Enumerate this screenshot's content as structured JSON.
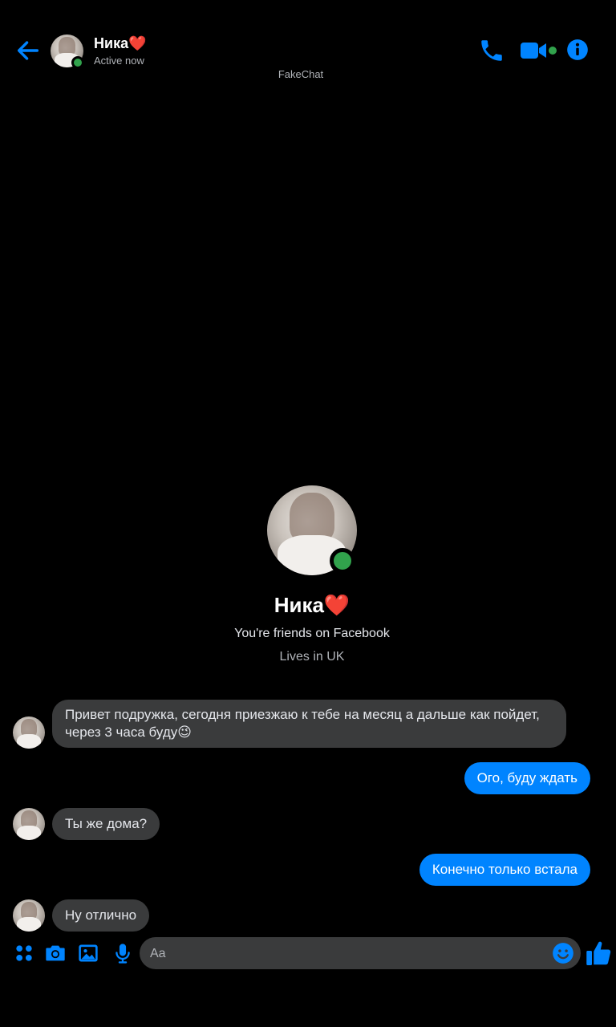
{
  "header": {
    "contact_name": "Ника❤️",
    "status": "Active now",
    "watermark": "FakeChat",
    "icons": [
      "back-arrow-icon",
      "phone-icon",
      "video-camera-icon",
      "info-icon"
    ]
  },
  "profile": {
    "name": "Ника❤️",
    "friends_text": "You're friends on Facebook",
    "location_text": "Lives in UK"
  },
  "messages": [
    {
      "direction": "incoming",
      "text": "Привет подружка, сегодня приезжаю к тебе на месяц а дальше как пойдет, через 3 часа буду😉"
    },
    {
      "direction": "outgoing",
      "text": "Ого, буду ждать"
    },
    {
      "direction": "incoming",
      "text": "Ты же дома?"
    },
    {
      "direction": "outgoing",
      "text": "Конечно только встала"
    },
    {
      "direction": "incoming",
      "text": "Ну отлично"
    }
  ],
  "composer": {
    "placeholder": "Aa",
    "icons": [
      "apps-grid-icon",
      "camera-icon",
      "gallery-icon",
      "microphone-icon",
      "emoji-icon",
      "thumbs-up-icon"
    ]
  },
  "colors": {
    "accent": "#0084ff",
    "online": "#31a24c",
    "incoming_bubble": "#3a3b3c",
    "background": "#000000"
  }
}
